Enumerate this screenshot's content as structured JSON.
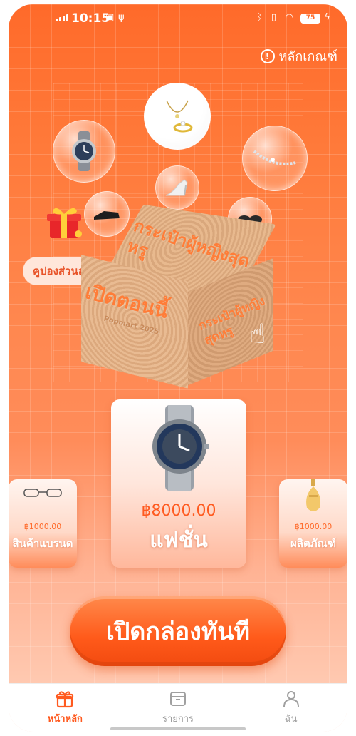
{
  "status_bar": {
    "time": "10:15",
    "battery": "75"
  },
  "header": {
    "rules_label": "หลักเกณฑ์"
  },
  "coupon_label": "คูปองส่วนลด",
  "box": {
    "top_text": "กระเป๋าผู้หญิงสุดหรู",
    "front_text": "เปิดตอนนี้",
    "front_subtext": "Popmart 2025",
    "side_text": "กระเป๋าผู้หญิงสุดหรู"
  },
  "products": {
    "left": {
      "price": "฿1000.00",
      "category": "สินค้าแบรนด"
    },
    "center": {
      "price": "฿8000.00",
      "category": "แฟชั่น"
    },
    "right": {
      "price": "฿1000.00",
      "category": "ผลิตภัณฑ์"
    }
  },
  "cta_label": "เปิดกล่องทันที",
  "tabs": [
    {
      "label": "หน้าหลัก",
      "icon": "gift-box-icon",
      "active": true
    },
    {
      "label": "รายการ",
      "icon": "archive-box-icon",
      "active": false
    },
    {
      "label": "ฉัน",
      "icon": "person-icon",
      "active": false
    }
  ],
  "colors": {
    "accent": "#ff5a1f",
    "background_top": "#ff6a2a",
    "background_bottom": "#ffd3bf"
  }
}
